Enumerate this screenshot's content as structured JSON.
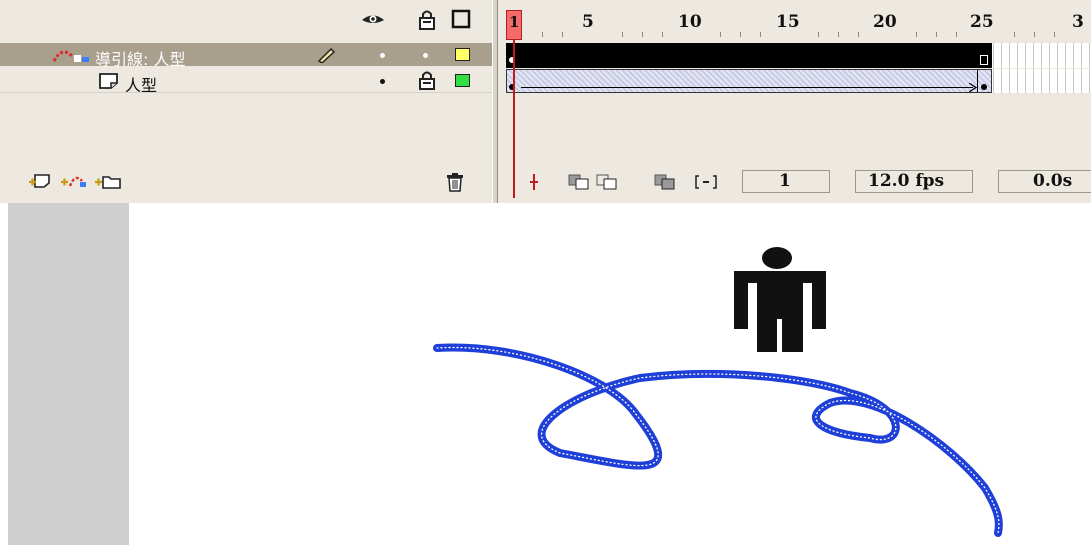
{
  "timeline": {
    "header_icons": [
      "eye-icon",
      "lock-icon",
      "outline-icon"
    ],
    "layers": [
      {
        "name": "導引線: 人型",
        "type": "guide",
        "icon": "motion-guide-icon",
        "selected": true,
        "color": "#ffff66",
        "edit_icon": "pencil-icon"
      },
      {
        "name": "人型",
        "type": "normal",
        "icon": "layer-icon",
        "selected": false,
        "color": "#33dd44",
        "locked": true
      }
    ],
    "footer_icons": [
      "insert-layer-icon",
      "add-motion-guide-icon",
      "insert-folder-icon",
      "trash-icon"
    ],
    "ruler_labels": [
      "5",
      "10",
      "15",
      "20",
      "25",
      "3"
    ],
    "current_frame_label": "1",
    "status": {
      "current_frame": "1",
      "fps": "12.0 fps",
      "elapsed": "0.0s"
    },
    "status_icons": [
      "center-frame-icon",
      "onion-skin-icon",
      "onion-skin-outlines-icon",
      "edit-multiple-frames-icon",
      "modify-onion-markers-icon"
    ],
    "colors": {
      "playhead": "#f36b6b",
      "guide_path": "#1e3fd8",
      "figure": "#111111"
    }
  },
  "stage": {
    "symbol": "person-figure-icon",
    "guide_path": "motion-guide-curve"
  }
}
